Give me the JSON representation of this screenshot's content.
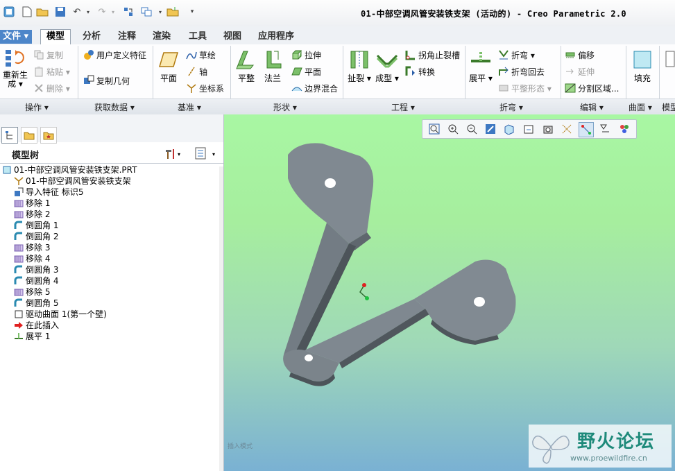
{
  "window": {
    "title": "01-中部空调风管安装铁支架 (活动的) - Creo Parametric 2.0"
  },
  "tabs": [
    {
      "label": "文件 ▾"
    },
    {
      "label": "模型"
    },
    {
      "label": "分析"
    },
    {
      "label": "注释"
    },
    {
      "label": "渲染"
    },
    {
      "label": "工具"
    },
    {
      "label": "视图"
    },
    {
      "label": "应用程序"
    }
  ],
  "ribbon": {
    "operations": {
      "group": "操作 ▾",
      "regenerate": "重新生",
      "regenerate2": "成 ▾",
      "copy": "复制",
      "paste": "粘贴 ▾",
      "delete": "删除 ▾"
    },
    "get_data": {
      "group": "获取数据 ▾",
      "udf": "用户定义特征",
      "copy_geom": "复制几何"
    },
    "datum": {
      "group": "基准 ▾",
      "plane": "平面",
      "sketch": "草绘",
      "axis": "轴",
      "csys": "坐标系"
    },
    "shapes": {
      "group": "形状 ▾",
      "flat": "平整",
      "flange": "法兰",
      "extrude": "拉伸",
      "planar": "平面",
      "blend": "边界混合"
    },
    "engineering": {
      "group": "工程 ▾",
      "rip": "扯裂 ▾",
      "form": "成型 ▾",
      "corner_relief": "拐角止裂槽",
      "convert": "转换"
    },
    "bends": {
      "group": "折弯 ▾",
      "unbend": "展平 ▾",
      "bend": "折弯 ▾",
      "bend_back": "折弯回去",
      "flat_state": "平整形态 ▾"
    },
    "editing": {
      "group": "编辑 ▾",
      "offset": "偏移",
      "extend": "延伸",
      "split": "分割区域..."
    },
    "surfaces": {
      "group": "曲面 ▾",
      "fill": "填充"
    },
    "model_intent": {
      "group": "模型"
    }
  },
  "model_tree": {
    "title": "模型树",
    "items": [
      {
        "label": "01-中部空调风管安装铁支架.PRT",
        "icon": "part-icon",
        "indent": 0
      },
      {
        "label": "01-中部空调风管安装铁支架",
        "icon": "csys-icon",
        "indent": 1
      },
      {
        "label": "导入特征 标识5",
        "icon": "import-feature-icon",
        "indent": 1
      },
      {
        "label": "移除 1",
        "icon": "remove-icon",
        "indent": 1
      },
      {
        "label": "移除 2",
        "icon": "remove-icon",
        "indent": 1
      },
      {
        "label": "倒圆角 1",
        "icon": "round-icon",
        "indent": 1
      },
      {
        "label": "倒圆角 2",
        "icon": "round-icon",
        "indent": 1
      },
      {
        "label": "移除 3",
        "icon": "remove-icon",
        "indent": 1
      },
      {
        "label": "移除 4",
        "icon": "remove-icon",
        "indent": 1
      },
      {
        "label": "倒圆角 3",
        "icon": "round-icon",
        "indent": 1
      },
      {
        "label": "倒圆角 4",
        "icon": "round-icon",
        "indent": 1
      },
      {
        "label": "移除 5",
        "icon": "remove-icon",
        "indent": 1
      },
      {
        "label": "倒圆角 5",
        "icon": "round-icon",
        "indent": 1
      },
      {
        "label": "驱动曲面 1(第一个壁)",
        "icon": "driving-surface-icon",
        "indent": 1
      },
      {
        "label": "在此插入",
        "icon": "insert-here-arrow-icon",
        "indent": 1
      },
      {
        "label": "展平 1",
        "icon": "unbend-icon",
        "indent": 1
      }
    ]
  },
  "viewport": {
    "hint": "插入模式"
  },
  "watermark": {
    "name": "野火论坛",
    "url": "www.proewildfire.cn"
  },
  "colors": {
    "accent": "#4d86c9",
    "part": "#7b8690",
    "bg_top": "#a8f7a3",
    "bg_bottom": "#7ab1d3"
  }
}
